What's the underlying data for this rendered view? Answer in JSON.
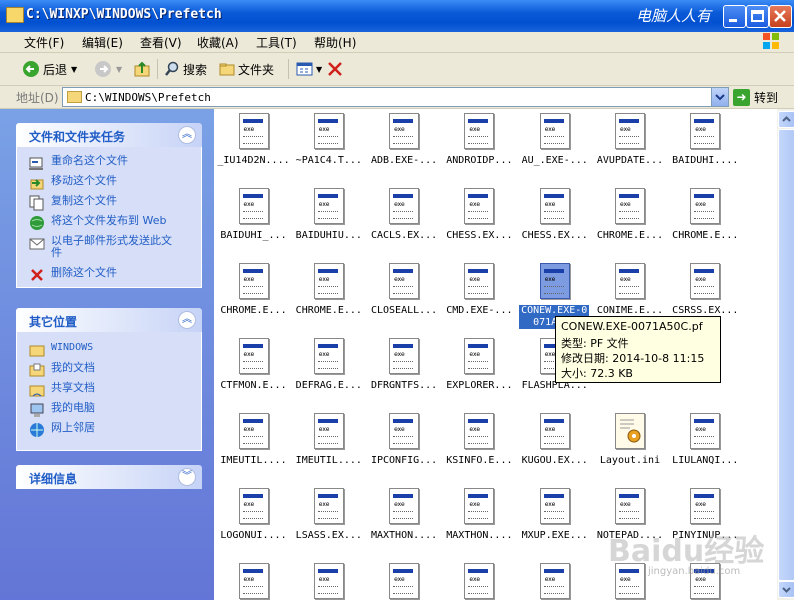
{
  "window": {
    "title": "C:\\WINXP\\WINDOWS\\Prefetch",
    "watermark": "电脑人人有"
  },
  "menu": [
    "文件(F)",
    "编辑(E)",
    "查看(V)",
    "收藏(A)",
    "工具(T)",
    "帮助(H)"
  ],
  "toolbar": {
    "back": "后退",
    "search": "搜索",
    "folders": "文件夹"
  },
  "address": {
    "label": "地址(D)",
    "path": "C:\\WINDOWS\\Prefetch",
    "go": "转到"
  },
  "tasks_panel": {
    "title": "文件和文件夹任务",
    "items": [
      "重命名这个文件",
      "移动这个文件",
      "复制这个文件",
      "将这个文件发布到 Web",
      "以电子邮件形式发送此文件",
      "删除这个文件"
    ]
  },
  "places_panel": {
    "title": "其它位置",
    "items": [
      "WINDOWS",
      "我的文档",
      "共享文档",
      "我的电脑",
      "网上邻居"
    ]
  },
  "details_panel": {
    "title": "详细信息"
  },
  "files": [
    "_IU14D2N....",
    "~PA1C4.T...",
    "ADB.EXE-...",
    "ANDROIDP...",
    "AU_.EXE-...",
    "AVUPDATE...",
    "BAIDUHI....",
    "BAIDUHI_...",
    "BAIDUHIU...",
    "CACLS.EX...",
    "CHESS.EX...",
    "CHESS.EX...",
    "CHROME.E...",
    "CHROME.E...",
    "CHROME.E...",
    "CHROME.E...",
    "CLOSEALL...",
    "CMD.EXE-...",
    "CONEW.EXE-0071A50C.pf",
    "CONIME.E...",
    "CSRSS.EX...",
    "CTFMON.E...",
    "DEFRAG.E...",
    "DFRGNTFS...",
    "EXPLORER...",
    "FLASHPLA...",
    "",
    "",
    "IMEUTIL....",
    "IMEUTIL....",
    "IPCONFIG...",
    "KSINFO.E...",
    "KUGOU.EX...",
    "Layout.ini",
    "LIULANQI...",
    "LOGONUI....",
    "LSASS.EX...",
    "MAXTHON....",
    "MAXTHON....",
    "MXUP.EXE...",
    "NOTEPAD....",
    "PINYINUP...",
    "",
    "",
    "",
    "",
    "",
    "",
    ""
  ],
  "selected_file_label": "CONEW.EXE-0071A50C",
  "tooltip": {
    "name": "CONEW.EXE-0071A50C.pf",
    "type": "类型: PF 文件",
    "modified": "修改日期: 2014-10-8 11:15",
    "size": "大小: 72.3 KB"
  },
  "watermark": {
    "brand": "Baidu经验",
    "url": "jingyan.baidu.com"
  },
  "colors": {
    "title_blue": "#0054e3",
    "task_link": "#215dc6",
    "selection": "#316ac5",
    "tooltip_bg": "#ffffe1"
  }
}
